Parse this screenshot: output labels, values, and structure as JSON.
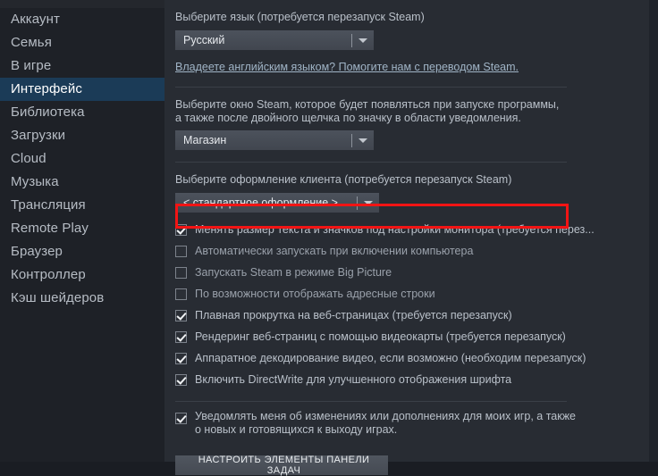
{
  "sidebar": {
    "items": [
      {
        "label": "Аккаунт",
        "selected": false
      },
      {
        "label": "Семья",
        "selected": false
      },
      {
        "label": "В игре",
        "selected": false
      },
      {
        "label": "Интерфейс",
        "selected": true
      },
      {
        "label": "Библиотека",
        "selected": false
      },
      {
        "label": "Загрузки",
        "selected": false
      },
      {
        "label": "Cloud",
        "selected": false
      },
      {
        "label": "Музыка",
        "selected": false
      },
      {
        "label": "Трансляция",
        "selected": false
      },
      {
        "label": "Remote Play",
        "selected": false
      },
      {
        "label": "Браузер",
        "selected": false
      },
      {
        "label": "Контроллер",
        "selected": false
      },
      {
        "label": "Кэш шейдеров",
        "selected": false
      }
    ]
  },
  "content": {
    "language_section": {
      "label": "Выберите язык (потребуется перезапуск Steam)",
      "dropdown_value": "Русский",
      "link": "Владеете английским языком? Помогите нам с переводом Steam."
    },
    "startup_window_section": {
      "label": "Выберите окно Steam, которое будет появляться при запуске программы, а также после двойного щелчка по значку в области уведомления.",
      "dropdown_value": "Магазин"
    },
    "skin_section": {
      "label": "Выберите оформление клиента (потребуется перезапуск Steam)",
      "dropdown_value": "< стандартное оформление >"
    },
    "checkboxes": [
      {
        "label": "Менять размер текста и значков под настройки монитора (требуется перез...",
        "checked": true,
        "highlighted": true
      },
      {
        "label": "Автоматически запускать при включении компьютера",
        "checked": false,
        "highlighted": false
      },
      {
        "label": "Запускать Steam в режиме Big Picture",
        "checked": false,
        "highlighted": false
      },
      {
        "label": "По возможности отображать адресные строки",
        "checked": false,
        "highlighted": false
      },
      {
        "label": "Плавная прокрутка на веб-страницах (требуется перезапуск)",
        "checked": true,
        "highlighted": false
      },
      {
        "label": "Рендеринг веб-страниц с помощью видеокарты (требуется перезапуск)",
        "checked": true,
        "highlighted": false
      },
      {
        "label": "Аппаратное декодирование видео, если возможно (необходим перезапуск)",
        "checked": true,
        "highlighted": false
      },
      {
        "label": "Включить DirectWrite для улучшенного отображения шрифта",
        "checked": true,
        "highlighted": false
      }
    ],
    "notify_checkbox": {
      "label": "Уведомлять меня об изменениях или дополнениях для моих игр, а также о новых и готовящихся к выходу играх.",
      "checked": true
    },
    "taskbar_button": "НАСТРОИТЬ ЭЛЕМЕНТЫ ПАНЕЛИ ЗАДАЧ"
  },
  "colors": {
    "highlight_red": "#f21414",
    "selected_nav": "#1b3b57",
    "content_bg": "#282c33",
    "sidebar_bg": "#1e2127"
  }
}
